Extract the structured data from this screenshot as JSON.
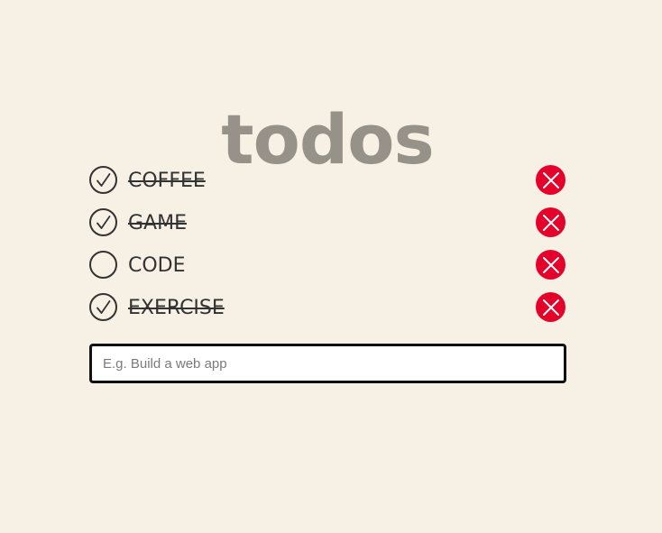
{
  "app": {
    "title": "todos"
  },
  "todos": [
    {
      "text": "COFFEE",
      "completed": true
    },
    {
      "text": "GAME",
      "completed": true
    },
    {
      "text": "CODE",
      "completed": false
    },
    {
      "text": "EXERCISE",
      "completed": true
    }
  ],
  "new_todo": {
    "value": "",
    "placeholder": "E.g. Build a web app"
  },
  "icons": {
    "check": "check-icon",
    "delete": "close-icon"
  },
  "colors": {
    "background": "#f7f1e5",
    "title": "#979289",
    "text": "#333333",
    "delete": "#e4022b"
  }
}
